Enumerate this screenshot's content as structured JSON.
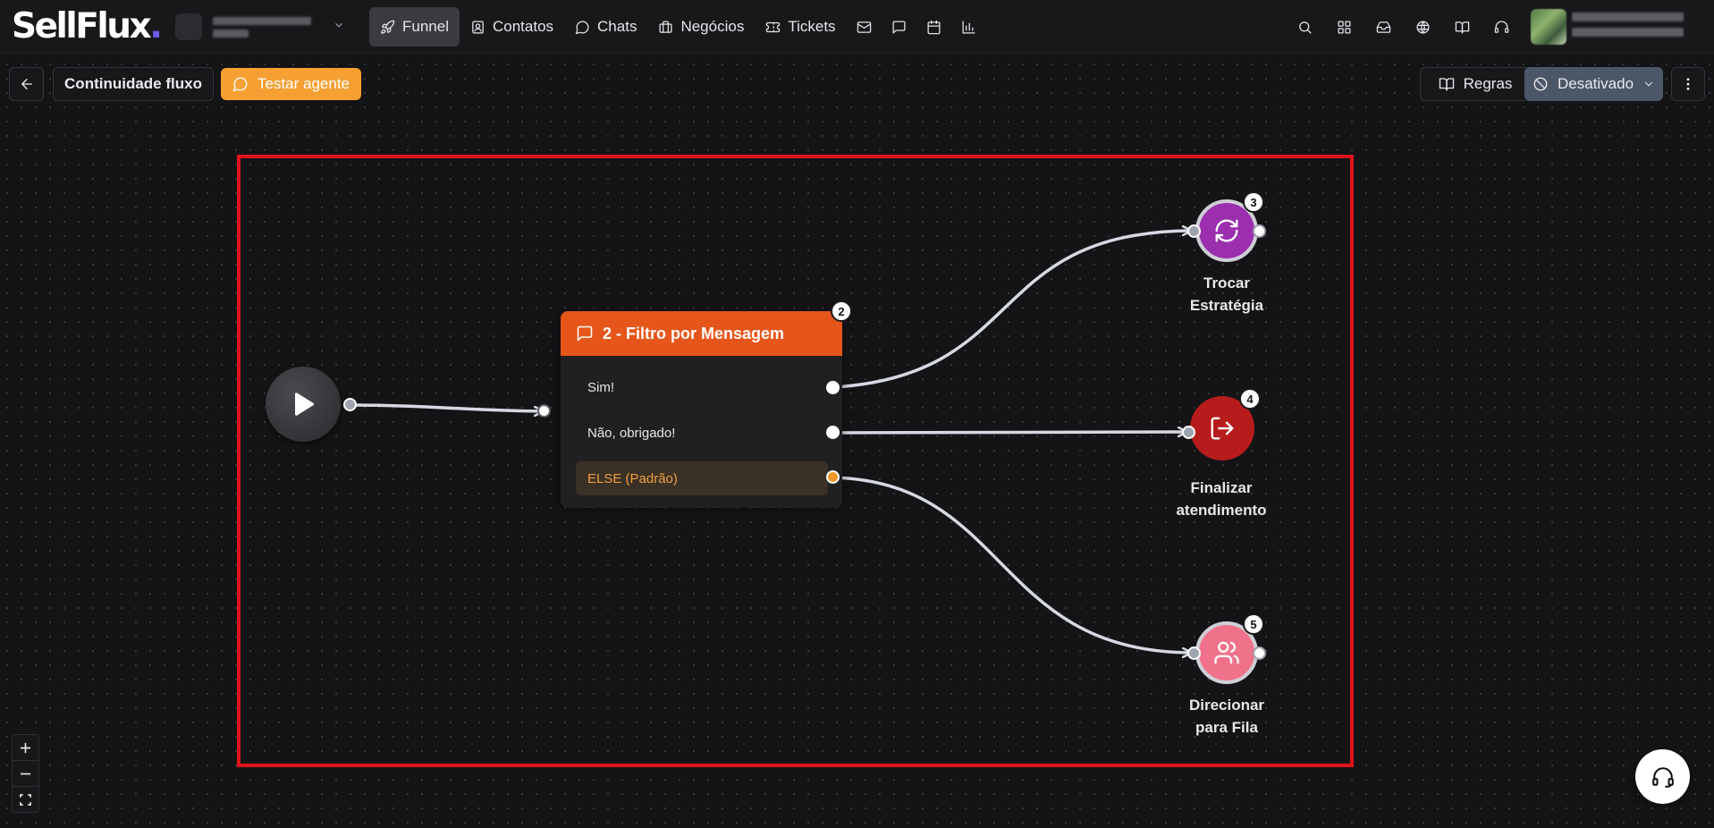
{
  "app": {
    "logo_text": "SellFlux",
    "logo_dot": "."
  },
  "nav": {
    "items": [
      {
        "label": "Funnel",
        "icon": "rocket-icon",
        "active": true
      },
      {
        "label": "Contatos",
        "icon": "contacts-icon",
        "active": false
      },
      {
        "label": "Chats",
        "icon": "chat-icon",
        "active": false
      },
      {
        "label": "Negócios",
        "icon": "briefcase-icon",
        "active": false
      },
      {
        "label": "Tickets",
        "icon": "ticket-icon",
        "active": false
      }
    ],
    "extra_icons": [
      "mail-icon",
      "message-square-icon",
      "calendar-icon",
      "bar-chart-icon"
    ]
  },
  "header_right_icons": [
    "search-icon",
    "apps-grid-icon",
    "inbox-icon",
    "globe-icon",
    "book-icon",
    "headset-icon"
  ],
  "toolbar": {
    "title": "Continuidade fluxo",
    "test_label": "Testar agente",
    "rules_label": "Regras",
    "status_label": "Desativado"
  },
  "flow": {
    "filter_node": {
      "badge": "2",
      "title": "2 - Filtro por Mensagem",
      "options": [
        "Sim!",
        "Não, obrigado!",
        "ELSE (Padrão)"
      ]
    },
    "action_nodes": [
      {
        "badge": "3",
        "label_line1": "Trocar",
        "label_line2": "Estratégia",
        "color": "#9b2fae",
        "icon": "refresh-icon"
      },
      {
        "badge": "4",
        "label_line1": "Finalizar",
        "label_line2": "atendimento",
        "color": "#b71c1c",
        "icon": "log-out-icon"
      },
      {
        "badge": "5",
        "label_line1": "Direcionar",
        "label_line2": "para Fila",
        "color": "#f0728a",
        "icon": "users-icon"
      }
    ]
  },
  "colors": {
    "accent_orange": "#f6a033",
    "filter_header": "#e6561a",
    "status_button": "#4b5667",
    "highlight_border": "#e0141c",
    "edge": "#d5d9e2"
  }
}
